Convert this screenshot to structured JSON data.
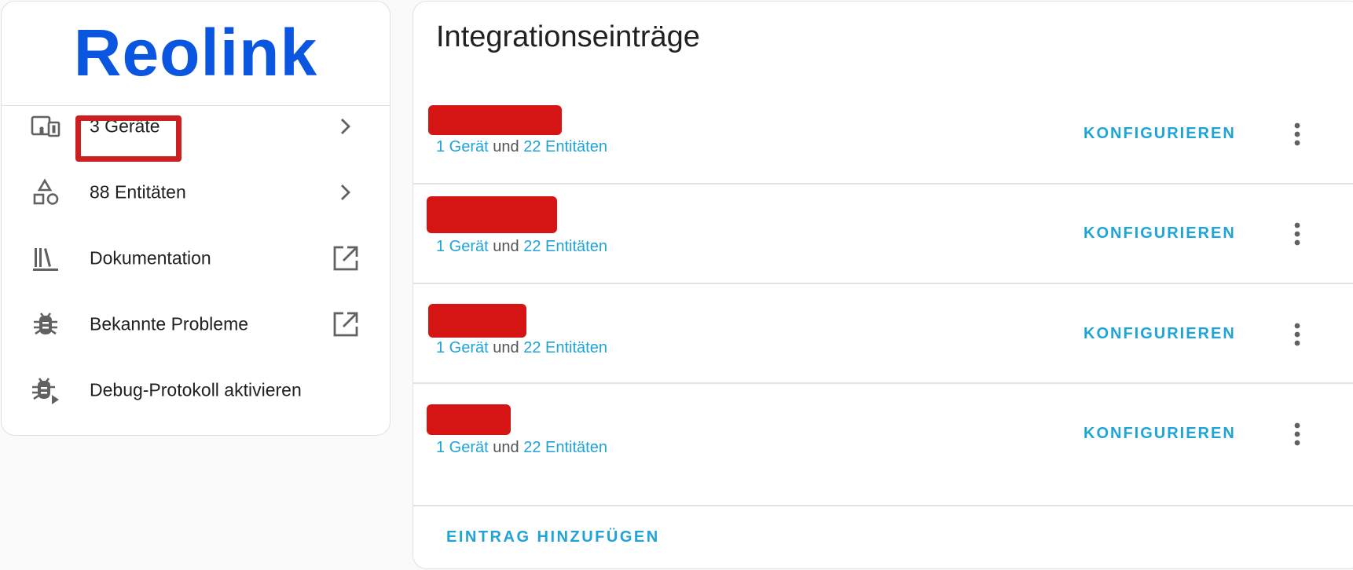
{
  "brand": {
    "logo_text": "Reolink",
    "logo_color": "#0a56e0"
  },
  "info_card": {
    "items": [
      {
        "label": "3 Geräte",
        "icon": "devices-icon",
        "trail": "chevron-right-icon"
      },
      {
        "label": "88 Entitäten",
        "icon": "shapes-icon",
        "trail": "chevron-right-icon"
      },
      {
        "label": "Dokumentation",
        "icon": "bookshelf-icon",
        "trail": "open-in-new-icon"
      },
      {
        "label": "Bekannte Probleme",
        "icon": "bug-icon",
        "trail": "open-in-new-icon"
      },
      {
        "label": "Debug-Protokoll aktivieren",
        "icon": "bug-play-icon",
        "trail": ""
      }
    ],
    "highlight_color": "#cc1f1f"
  },
  "entries_card": {
    "title": "Integrationseinträge",
    "entries": [
      {
        "device_link": "1 Gerät",
        "and_text": "und",
        "entity_link": "22 Entitäten",
        "configure_label": "KONFIGURIEREN"
      },
      {
        "device_link": "1 Gerät",
        "and_text": "und",
        "entity_link": "22 Entitäten",
        "configure_label": "KONFIGURIEREN"
      },
      {
        "device_link": "1 Gerät",
        "and_text": "und",
        "entity_link": "22 Entitäten",
        "configure_label": "KONFIGURIEREN"
      },
      {
        "device_link": "1 Gerät",
        "and_text": "und",
        "entity_link": "22 Entitäten",
        "configure_label": "KONFIGURIEREN"
      }
    ],
    "add_entry_label": "EINTRAG HINZUFÜGEN"
  },
  "colors": {
    "accent": "#1fa3d8",
    "redaction": "#d51414",
    "text": "#212121",
    "icon": "#616161"
  }
}
